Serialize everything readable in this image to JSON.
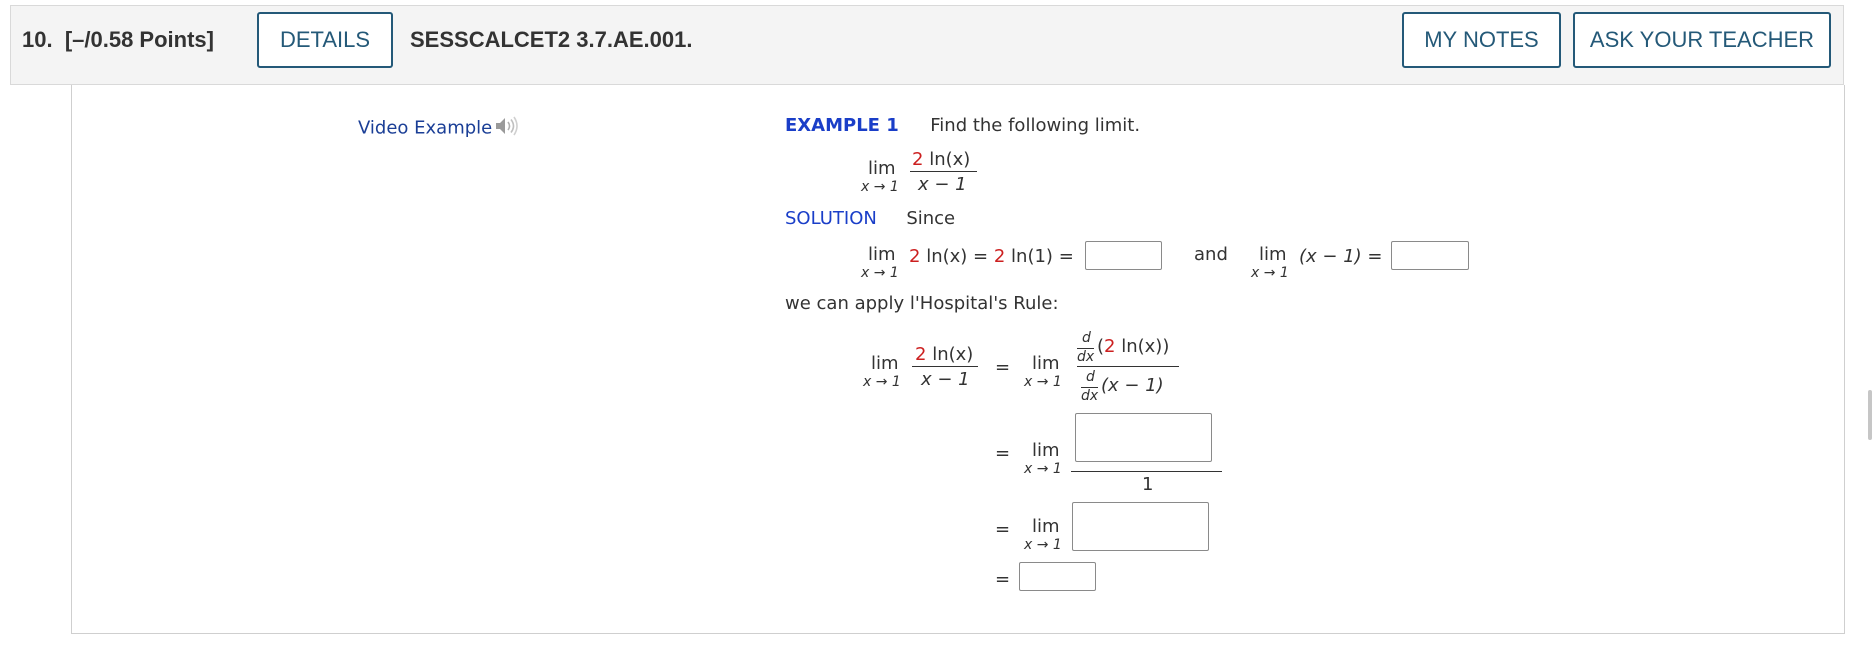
{
  "header": {
    "question_number": "10.",
    "points": "[–/0.58 Points]",
    "details_label": "DETAILS",
    "question_code": "SESSCALCET2 3.7.AE.001.",
    "my_notes_label": "MY NOTES",
    "ask_teacher_label": "ASK YOUR TEACHER"
  },
  "video": {
    "label": "Video Example",
    "icon": "speaker-icon"
  },
  "example": {
    "title": "EXAMPLE 1",
    "prompt": "Find the following limit.",
    "solution_label": "SOLUTION",
    "since": "Since",
    "and": "and",
    "apply_rule": "we can apply l'Hospital's Rule:"
  },
  "math": {
    "lim": "lim",
    "x_to_1": "x → 1",
    "coef": "2",
    "ln_x": "ln(x)",
    "ln_1": "ln(1)",
    "x_minus_1": "x − 1",
    "paren_x_minus_1": "(x − 1)",
    "d": "d",
    "dx": "dx",
    "eq": "=",
    "one": "1",
    "open_paren": "(",
    "close_paren": "))"
  },
  "answers": {
    "lim_numerator": "",
    "lim_denominator": "",
    "derivative_numerator": "",
    "simplified_expression": "",
    "final_value": ""
  },
  "colors": {
    "accent_blue": "#1a3ec8",
    "button_border": "#245978",
    "red": "#cc1f1f"
  }
}
